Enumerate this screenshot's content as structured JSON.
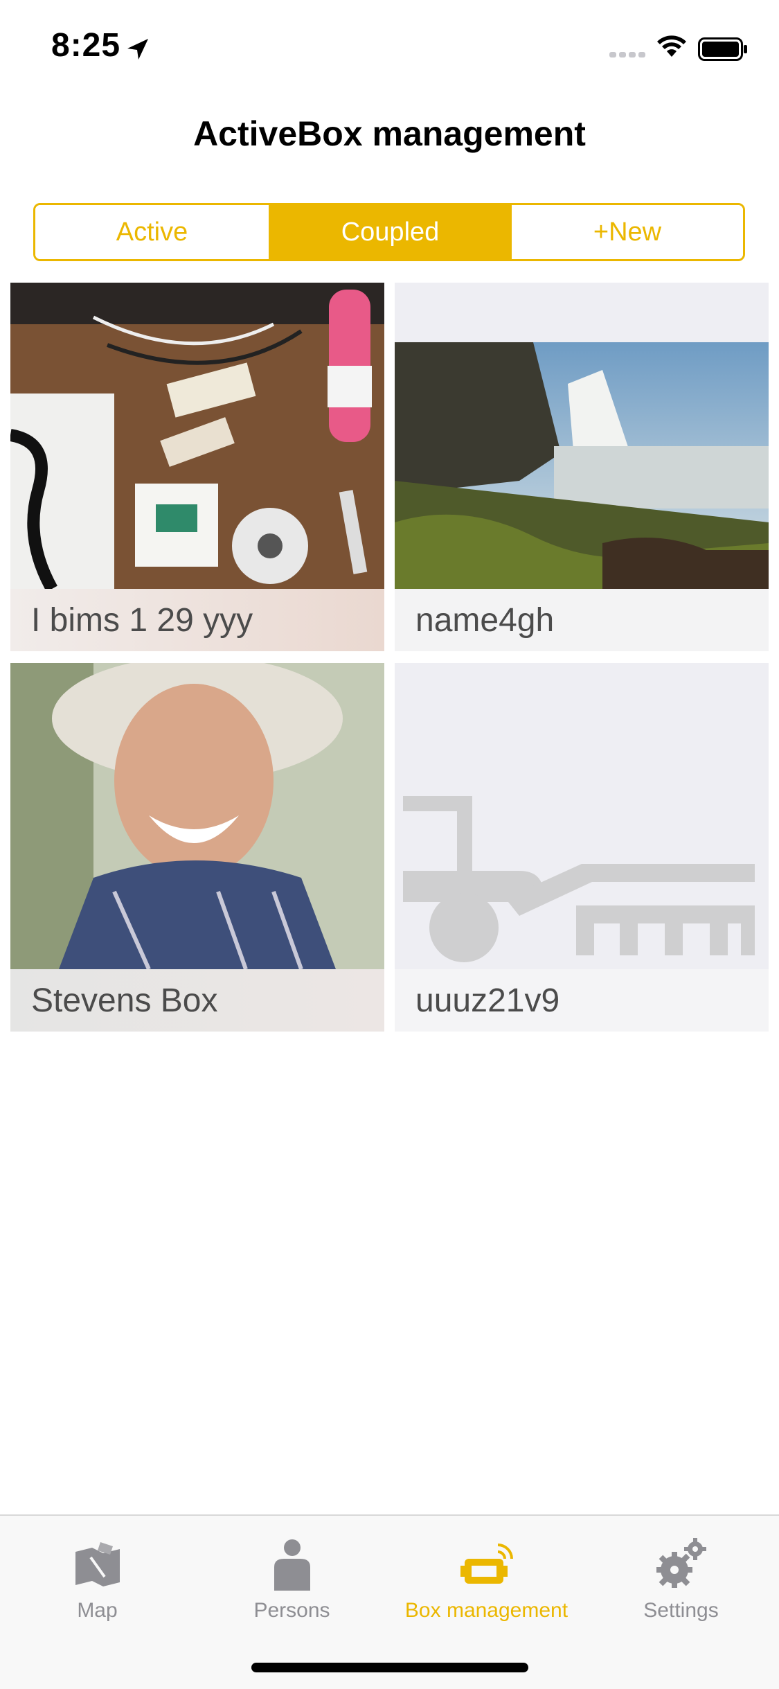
{
  "status": {
    "time": "8:25"
  },
  "header": {
    "title": "ActiveBox management"
  },
  "segments": [
    {
      "label": "Active"
    },
    {
      "label": "Coupled"
    },
    {
      "label": "+New"
    }
  ],
  "boxes": [
    {
      "name": "I bims 1 29 yyy"
    },
    {
      "name": "name4gh"
    },
    {
      "name": "Stevens Box"
    },
    {
      "name": "uuuz21v9"
    }
  ],
  "tabs": [
    {
      "label": "Map",
      "icon": "map-icon"
    },
    {
      "label": "Persons",
      "icon": "person-icon"
    },
    {
      "label": "Box management",
      "icon": "box-management-icon"
    },
    {
      "label": "Settings",
      "icon": "gear-icon"
    }
  ],
  "colors": {
    "accent": "#EBB700",
    "inactive": "#8e8e93"
  }
}
